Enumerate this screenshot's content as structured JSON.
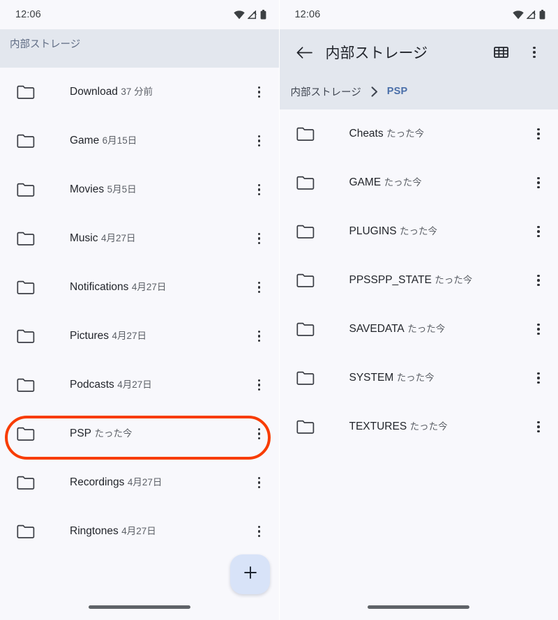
{
  "accent": {
    "highlight_ring": "#f83c00",
    "header_band": "#e3e7ee",
    "page_background": "#f8f8fc",
    "breadcrumb_link": "#4a6fa9",
    "fab_background": "#d8e3f8"
  },
  "left_screen": {
    "status_bar": {
      "clock": "12:06",
      "icons": [
        "wifi-icon",
        "cell-signal-off-icon",
        "battery-icon"
      ]
    },
    "breadcrumb": {
      "root_label": "内部ストレージ"
    },
    "fab": {
      "label": "+",
      "name": "add-button"
    },
    "items": [
      {
        "name": "Download",
        "modified": "37 分前"
      },
      {
        "name": "Game",
        "modified": "6月15日"
      },
      {
        "name": "Movies",
        "modified": "5月5日"
      },
      {
        "name": "Music",
        "modified": "4月27日"
      },
      {
        "name": "Notifications",
        "modified": "4月27日"
      },
      {
        "name": "Pictures",
        "modified": "4月27日"
      },
      {
        "name": "Podcasts",
        "modified": "4月27日"
      },
      {
        "name": "PSP",
        "modified": "たった今",
        "highlighted": true
      },
      {
        "name": "Recordings",
        "modified": "4月27日"
      },
      {
        "name": "Ringtones",
        "modified": "4月27日"
      }
    ]
  },
  "right_screen": {
    "status_bar": {
      "clock": "12:06",
      "icons": [
        "wifi-icon",
        "cell-signal-off-icon",
        "battery-icon"
      ]
    },
    "app_bar": {
      "back_label": "戻る",
      "title": "内部ストレージ",
      "grid_view_label": "グリッド表示",
      "overflow_label": "その他のオプション"
    },
    "breadcrumb": {
      "root_label": "内部ストレージ",
      "separator": "›",
      "current_label": "PSP"
    },
    "fab": {
      "label": "+",
      "name": "add-button"
    },
    "items": [
      {
        "name": "Cheats",
        "modified": "たった今"
      },
      {
        "name": "GAME",
        "modified": "たった今"
      },
      {
        "name": "PLUGINS",
        "modified": "たった今"
      },
      {
        "name": "PPSSPP_STATE",
        "modified": "たった今"
      },
      {
        "name": "SAVEDATA",
        "modified": "たった今"
      },
      {
        "name": "SYSTEM",
        "modified": "たった今"
      },
      {
        "name": "TEXTURES",
        "modified": "たった今"
      }
    ]
  }
}
